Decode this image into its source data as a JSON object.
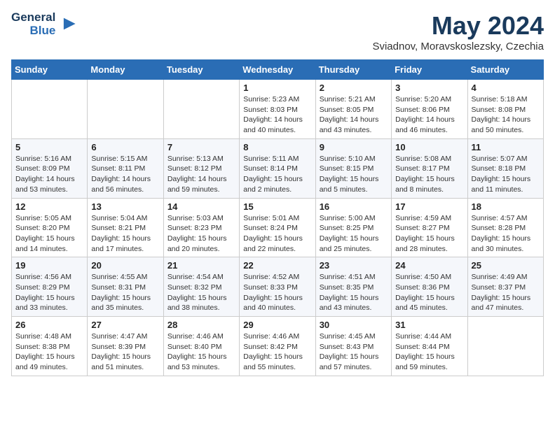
{
  "logo": {
    "line1": "General",
    "line2": "Blue",
    "bird": "▲"
  },
  "title": "May 2024",
  "subtitle": "Sviadnov, Moravskoslezsky, Czechia",
  "days_of_week": [
    "Sunday",
    "Monday",
    "Tuesday",
    "Wednesday",
    "Thursday",
    "Friday",
    "Saturday"
  ],
  "weeks": [
    [
      {
        "day": "",
        "info": ""
      },
      {
        "day": "",
        "info": ""
      },
      {
        "day": "",
        "info": ""
      },
      {
        "day": "1",
        "info": "Sunrise: 5:23 AM\nSunset: 8:03 PM\nDaylight: 14 hours\nand 40 minutes."
      },
      {
        "day": "2",
        "info": "Sunrise: 5:21 AM\nSunset: 8:05 PM\nDaylight: 14 hours\nand 43 minutes."
      },
      {
        "day": "3",
        "info": "Sunrise: 5:20 AM\nSunset: 8:06 PM\nDaylight: 14 hours\nand 46 minutes."
      },
      {
        "day": "4",
        "info": "Sunrise: 5:18 AM\nSunset: 8:08 PM\nDaylight: 14 hours\nand 50 minutes."
      }
    ],
    [
      {
        "day": "5",
        "info": "Sunrise: 5:16 AM\nSunset: 8:09 PM\nDaylight: 14 hours\nand 53 minutes."
      },
      {
        "day": "6",
        "info": "Sunrise: 5:15 AM\nSunset: 8:11 PM\nDaylight: 14 hours\nand 56 minutes."
      },
      {
        "day": "7",
        "info": "Sunrise: 5:13 AM\nSunset: 8:12 PM\nDaylight: 14 hours\nand 59 minutes."
      },
      {
        "day": "8",
        "info": "Sunrise: 5:11 AM\nSunset: 8:14 PM\nDaylight: 15 hours\nand 2 minutes."
      },
      {
        "day": "9",
        "info": "Sunrise: 5:10 AM\nSunset: 8:15 PM\nDaylight: 15 hours\nand 5 minutes."
      },
      {
        "day": "10",
        "info": "Sunrise: 5:08 AM\nSunset: 8:17 PM\nDaylight: 15 hours\nand 8 minutes."
      },
      {
        "day": "11",
        "info": "Sunrise: 5:07 AM\nSunset: 8:18 PM\nDaylight: 15 hours\nand 11 minutes."
      }
    ],
    [
      {
        "day": "12",
        "info": "Sunrise: 5:05 AM\nSunset: 8:20 PM\nDaylight: 15 hours\nand 14 minutes."
      },
      {
        "day": "13",
        "info": "Sunrise: 5:04 AM\nSunset: 8:21 PM\nDaylight: 15 hours\nand 17 minutes."
      },
      {
        "day": "14",
        "info": "Sunrise: 5:03 AM\nSunset: 8:23 PM\nDaylight: 15 hours\nand 20 minutes."
      },
      {
        "day": "15",
        "info": "Sunrise: 5:01 AM\nSunset: 8:24 PM\nDaylight: 15 hours\nand 22 minutes."
      },
      {
        "day": "16",
        "info": "Sunrise: 5:00 AM\nSunset: 8:25 PM\nDaylight: 15 hours\nand 25 minutes."
      },
      {
        "day": "17",
        "info": "Sunrise: 4:59 AM\nSunset: 8:27 PM\nDaylight: 15 hours\nand 28 minutes."
      },
      {
        "day": "18",
        "info": "Sunrise: 4:57 AM\nSunset: 8:28 PM\nDaylight: 15 hours\nand 30 minutes."
      }
    ],
    [
      {
        "day": "19",
        "info": "Sunrise: 4:56 AM\nSunset: 8:29 PM\nDaylight: 15 hours\nand 33 minutes."
      },
      {
        "day": "20",
        "info": "Sunrise: 4:55 AM\nSunset: 8:31 PM\nDaylight: 15 hours\nand 35 minutes."
      },
      {
        "day": "21",
        "info": "Sunrise: 4:54 AM\nSunset: 8:32 PM\nDaylight: 15 hours\nand 38 minutes."
      },
      {
        "day": "22",
        "info": "Sunrise: 4:52 AM\nSunset: 8:33 PM\nDaylight: 15 hours\nand 40 minutes."
      },
      {
        "day": "23",
        "info": "Sunrise: 4:51 AM\nSunset: 8:35 PM\nDaylight: 15 hours\nand 43 minutes."
      },
      {
        "day": "24",
        "info": "Sunrise: 4:50 AM\nSunset: 8:36 PM\nDaylight: 15 hours\nand 45 minutes."
      },
      {
        "day": "25",
        "info": "Sunrise: 4:49 AM\nSunset: 8:37 PM\nDaylight: 15 hours\nand 47 minutes."
      }
    ],
    [
      {
        "day": "26",
        "info": "Sunrise: 4:48 AM\nSunset: 8:38 PM\nDaylight: 15 hours\nand 49 minutes."
      },
      {
        "day": "27",
        "info": "Sunrise: 4:47 AM\nSunset: 8:39 PM\nDaylight: 15 hours\nand 51 minutes."
      },
      {
        "day": "28",
        "info": "Sunrise: 4:46 AM\nSunset: 8:40 PM\nDaylight: 15 hours\nand 53 minutes."
      },
      {
        "day": "29",
        "info": "Sunrise: 4:46 AM\nSunset: 8:42 PM\nDaylight: 15 hours\nand 55 minutes."
      },
      {
        "day": "30",
        "info": "Sunrise: 4:45 AM\nSunset: 8:43 PM\nDaylight: 15 hours\nand 57 minutes."
      },
      {
        "day": "31",
        "info": "Sunrise: 4:44 AM\nSunset: 8:44 PM\nDaylight: 15 hours\nand 59 minutes."
      },
      {
        "day": "",
        "info": ""
      }
    ]
  ]
}
